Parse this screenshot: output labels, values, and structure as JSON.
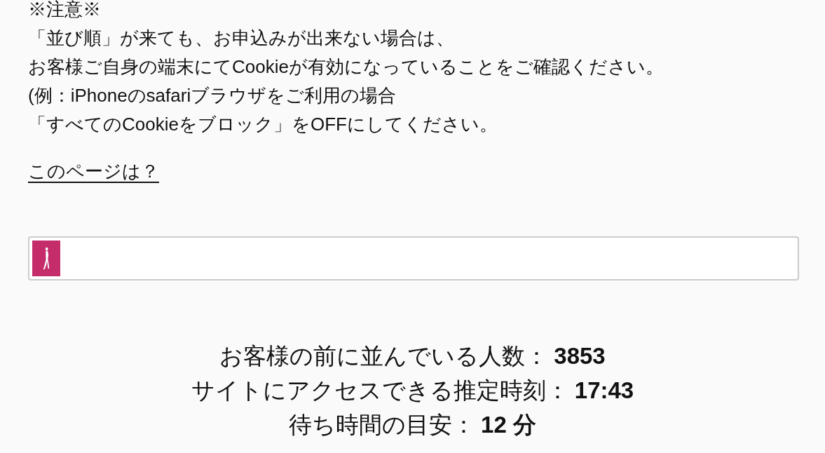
{
  "notice": {
    "title": "※注意※",
    "lines": [
      "「並び順」が来ても、お申込みが出来ない場合は、",
      "お客様ご自身の端末にてCookieが有効になっていることをご確認ください。",
      "(例：iPhoneのsafariブラウザをご利用の場合",
      "「すべてのCookieをブロック」をOFFにしてください。"
    ]
  },
  "about_link": "このページは？",
  "progress": {
    "level": 0.037
  },
  "queue": [
    {
      "label": "お客様の前に並んでいる人数：",
      "value": "3853"
    },
    {
      "label": "サイトにアクセスできる推定時刻：",
      "value": "17:43"
    },
    {
      "label": "待ち時間の目安：",
      "value": "12 分"
    }
  ]
}
